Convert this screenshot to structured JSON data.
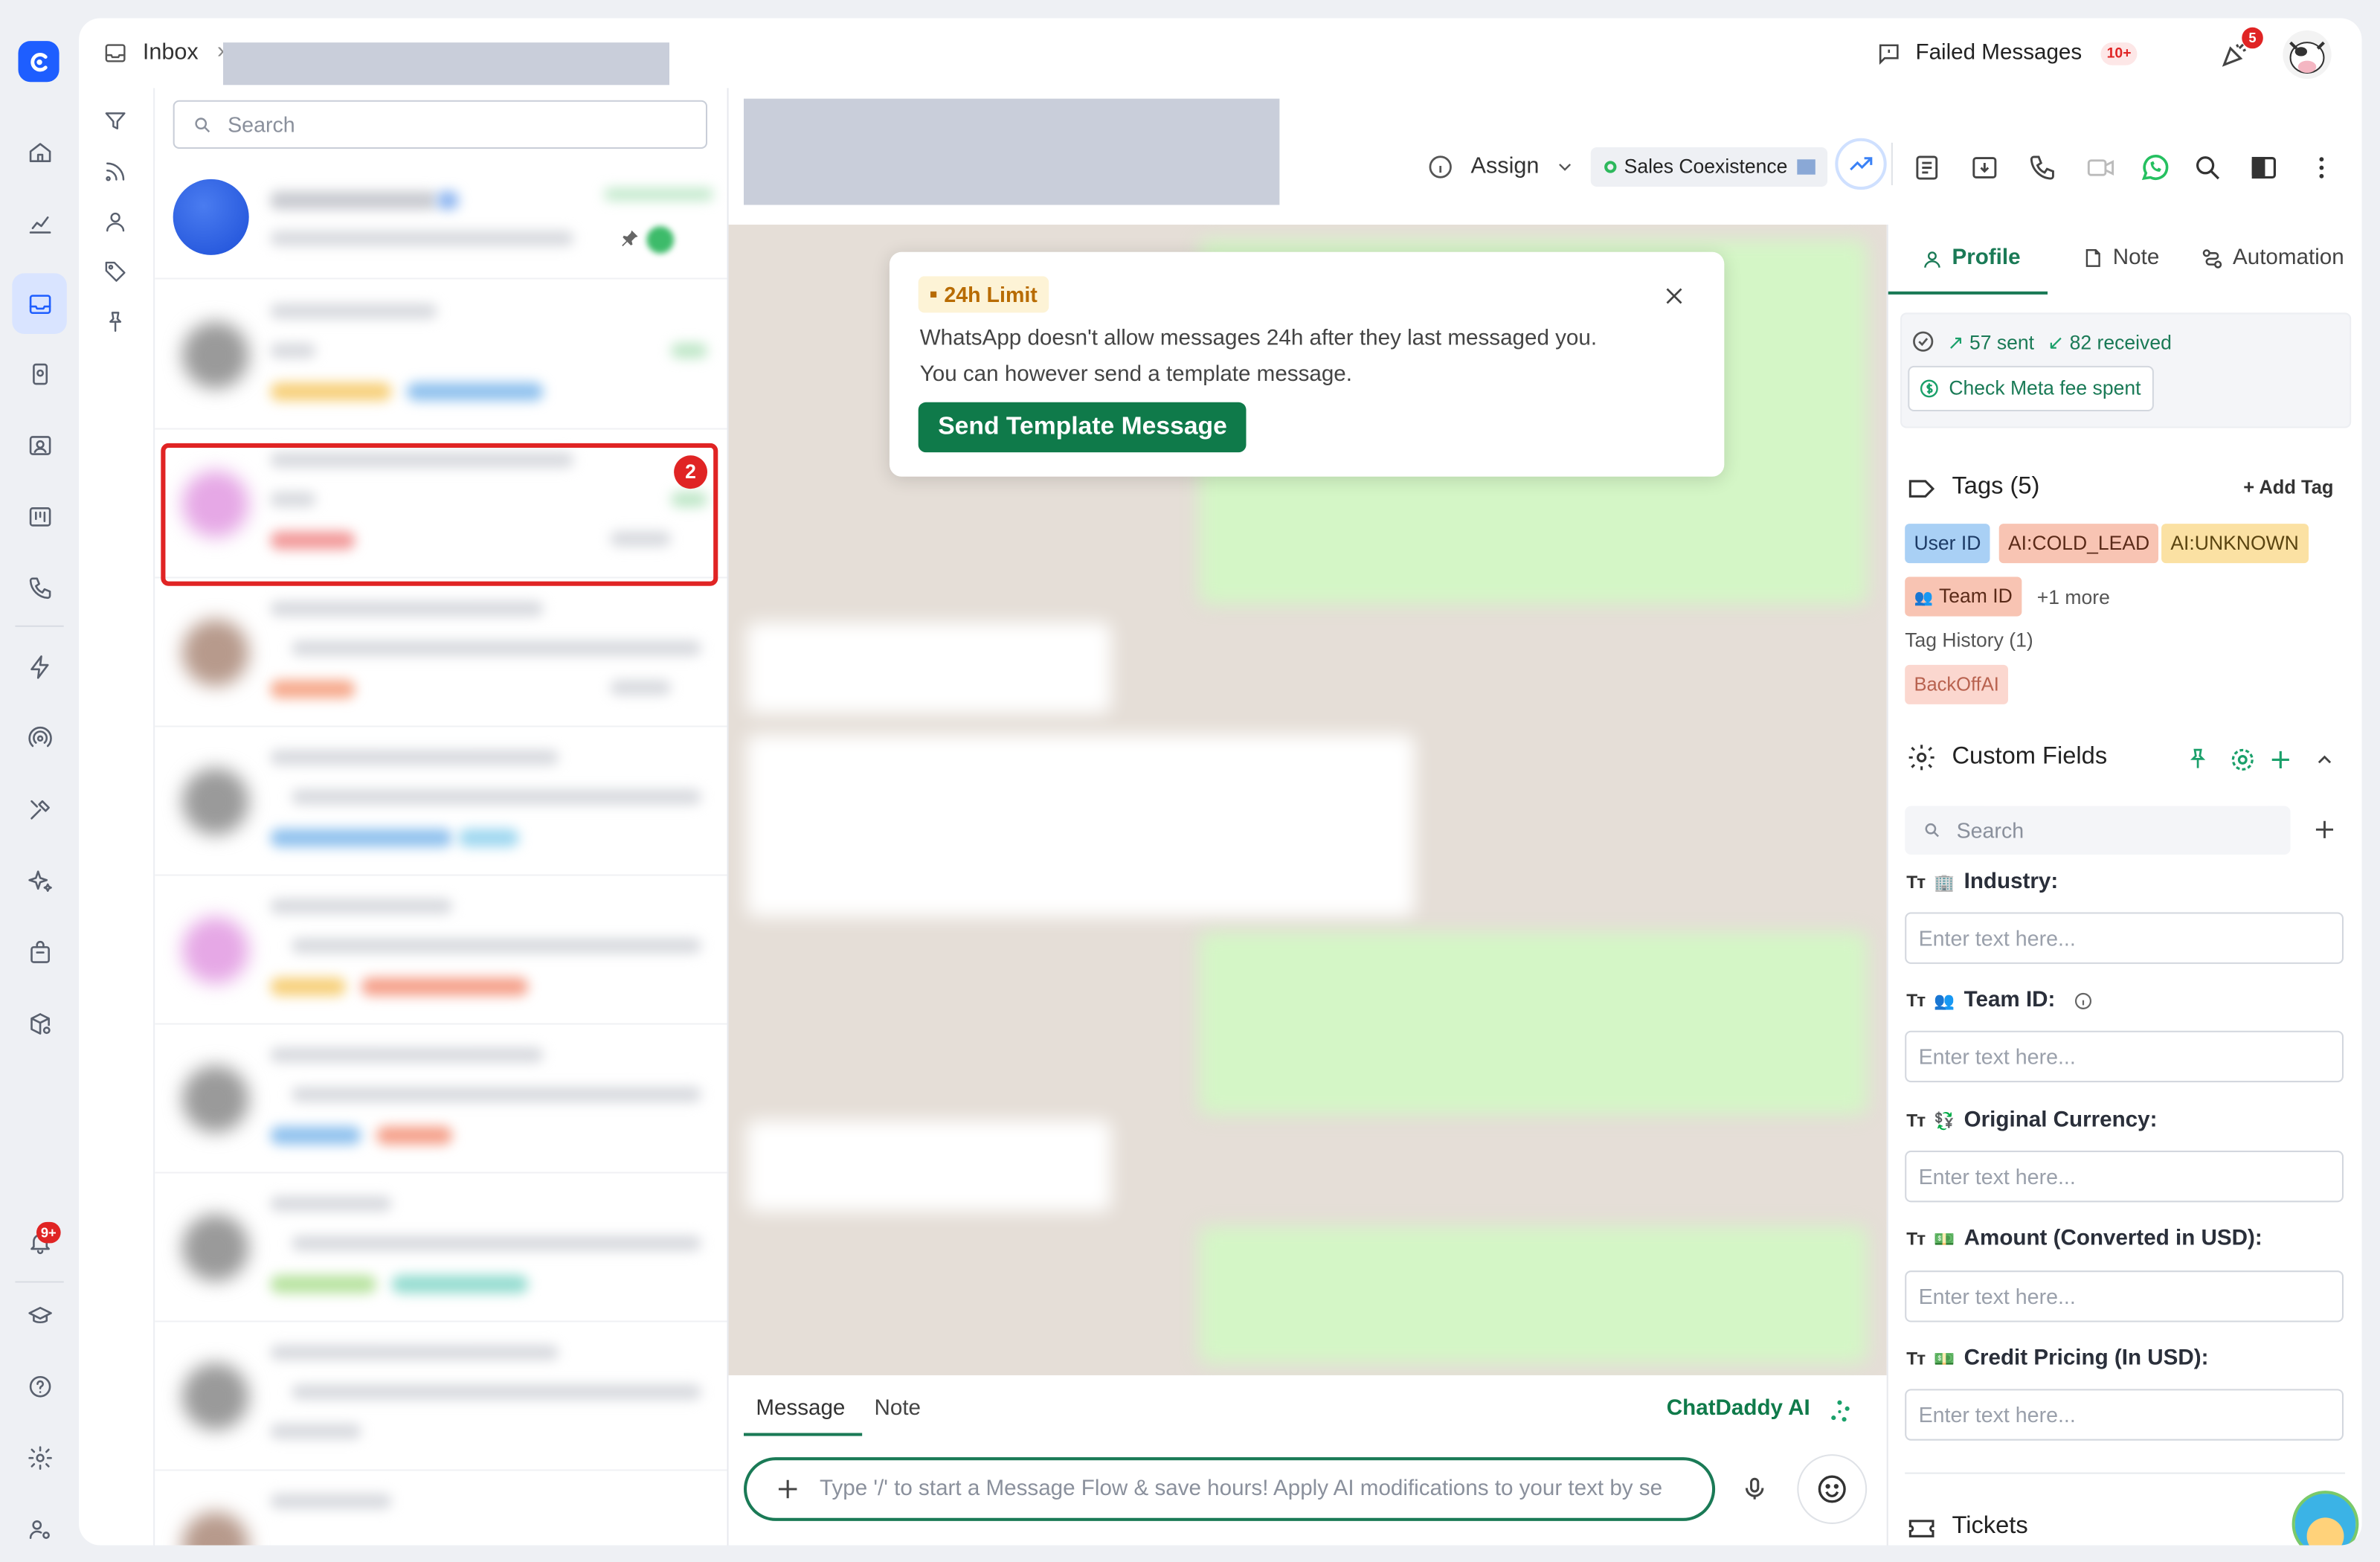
{
  "topbar": {
    "crumb": "Inbox",
    "crumb_sep": "›",
    "failed_label": "Failed Messages",
    "failed_badge": "10+",
    "notif_badge": "5"
  },
  "rail": {
    "notif_badge": "9+"
  },
  "list": {
    "search_placeholder": "Search",
    "selected_badge": "2"
  },
  "chat_header": {
    "assign_label": "Assign",
    "account_label": "Sales Coexistence"
  },
  "popup": {
    "badge": "24h Limit",
    "line1": "WhatsApp doesn't allow messages 24h after they last messaged you.",
    "line2": "You can however send a template message.",
    "button": "Send Template Message"
  },
  "composer": {
    "tab_message": "Message",
    "tab_note": "Note",
    "ai_label": "ChatDaddy AI",
    "placeholder": "Type '/' to start a Message Flow & save hours! Apply AI modifications to your text by se"
  },
  "panel": {
    "tabs": [
      "Profile",
      "Note",
      "Automation"
    ],
    "sent": "57 sent",
    "received": "82 received",
    "meta_fee": "Check Meta fee spent",
    "tags_title": "Tags (5)",
    "add_tag": "+ Add Tag",
    "tags": [
      "User ID",
      "AI:COLD_LEAD",
      "AI:UNKNOWN",
      "Team ID",
      "+1 more"
    ],
    "tag_history": "Tag History (1)",
    "history_tag": "BackOffAI",
    "custom_fields_title": "Custom Fields",
    "cf_search": "Search",
    "fields": [
      {
        "label": "Industry:",
        "placeholder": "Enter text here..."
      },
      {
        "label": "Team ID:",
        "placeholder": "Enter text here..."
      },
      {
        "label": "Original Currency:",
        "placeholder": "Enter text here..."
      },
      {
        "label": "Amount (Converted in USD):",
        "placeholder": "Enter text here..."
      },
      {
        "label": "Credit Pricing (In USD):",
        "placeholder": "Enter text here..."
      }
    ],
    "tickets_title": "Tickets"
  },
  "colors": {
    "accent": "#1e5eff",
    "whatsapp": "#0f7a4a",
    "alert": "#e02424"
  }
}
